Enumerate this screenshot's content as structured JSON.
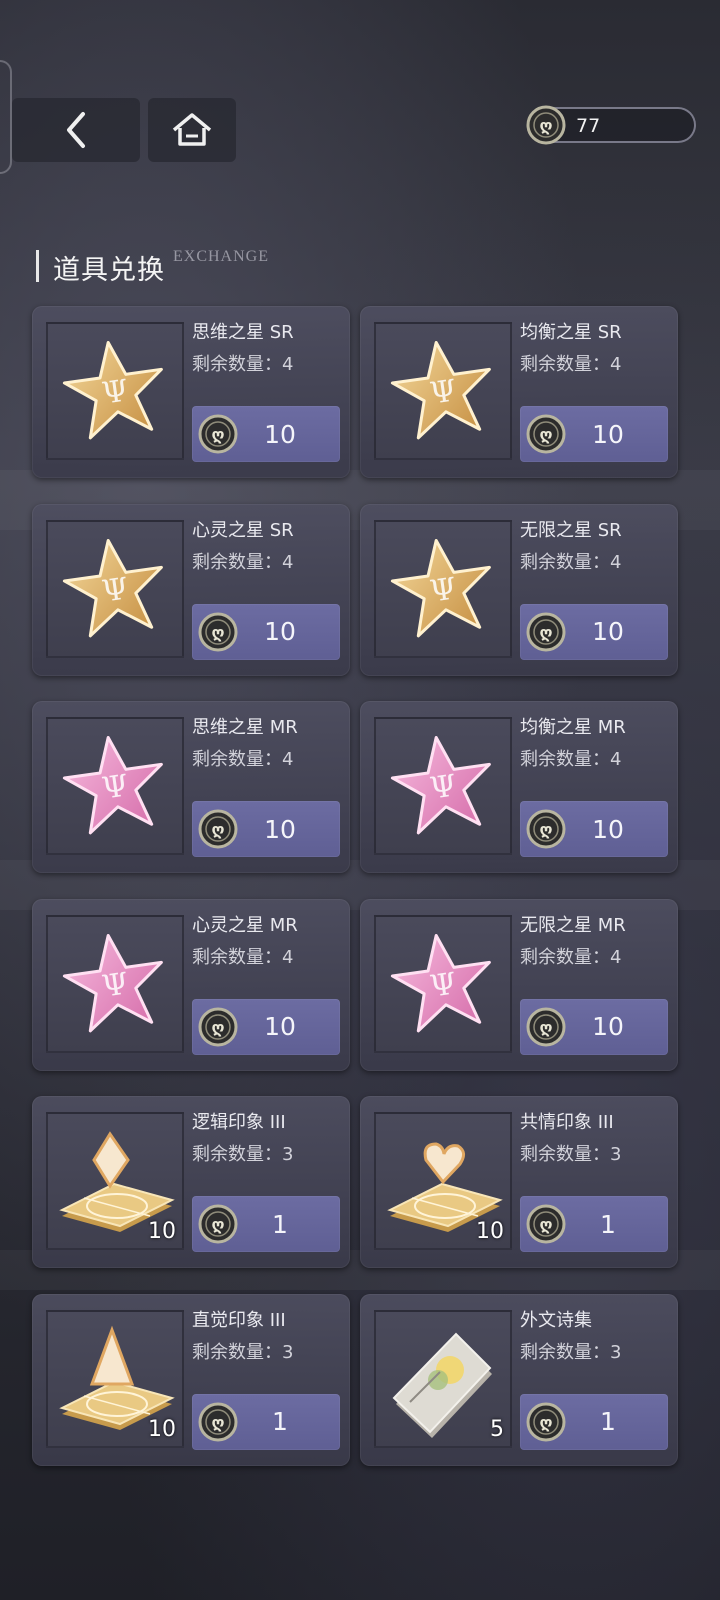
{
  "header": {
    "currency_amount": "77",
    "section_title": "道具兑换",
    "section_subtitle": "EXCHANGE"
  },
  "colors": {
    "button": "#6464a0",
    "card": "#4e4e60",
    "gold": "#e2b56a",
    "pink": "#e79ac8"
  },
  "items": [
    {
      "name": "思维之星 SR",
      "remain": "剩余数量：4",
      "price": "10",
      "qty": "",
      "icon": "gold-star-icon",
      "tone": "gold"
    },
    {
      "name": "均衡之星 SR",
      "remain": "剩余数量：4",
      "price": "10",
      "qty": "",
      "icon": "gold-star-icon",
      "tone": "gold"
    },
    {
      "name": "心灵之星 SR",
      "remain": "剩余数量：4",
      "price": "10",
      "qty": "",
      "icon": "gold-star-icon",
      "tone": "gold"
    },
    {
      "name": "无限之星 SR",
      "remain": "剩余数量：4",
      "price": "10",
      "qty": "",
      "icon": "gold-star-icon",
      "tone": "gold"
    },
    {
      "name": "思维之星 MR",
      "remain": "剩余数量：4",
      "price": "10",
      "qty": "",
      "icon": "pink-star-icon",
      "tone": "pink"
    },
    {
      "name": "均衡之星 MR",
      "remain": "剩余数量：4",
      "price": "10",
      "qty": "",
      "icon": "pink-star-icon",
      "tone": "pink"
    },
    {
      "name": "心灵之星 MR",
      "remain": "剩余数量：4",
      "price": "10",
      "qty": "",
      "icon": "pink-star-icon",
      "tone": "pink"
    },
    {
      "name": "无限之星 MR",
      "remain": "剩余数量：4",
      "price": "10",
      "qty": "",
      "icon": "pink-star-icon",
      "tone": "pink"
    },
    {
      "name": "逻辑印象 III",
      "remain": "剩余数量：3",
      "price": "1",
      "qty": "10",
      "icon": "diamond-impression-icon",
      "tone": "crystal"
    },
    {
      "name": "共情印象 III",
      "remain": "剩余数量：3",
      "price": "1",
      "qty": "10",
      "icon": "heart-impression-icon",
      "tone": "crystal"
    },
    {
      "name": "直觉印象 III",
      "remain": "剩余数量：3",
      "price": "1",
      "qty": "10",
      "icon": "triangle-impression-icon",
      "tone": "crystal"
    },
    {
      "name": "外文诗集",
      "remain": "剩余数量：3",
      "price": "1",
      "qty": "5",
      "icon": "poetry-book-icon",
      "tone": "book"
    }
  ]
}
